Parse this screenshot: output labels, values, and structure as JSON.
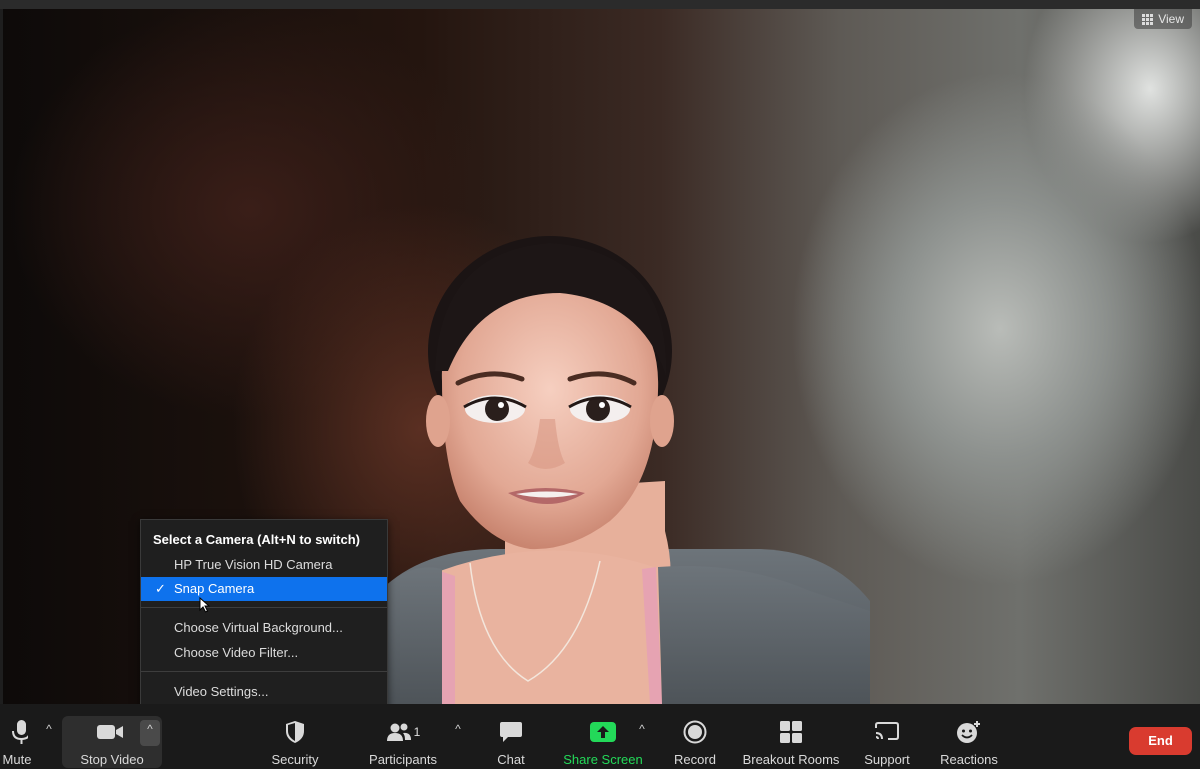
{
  "view_button": {
    "label": "View",
    "icon": "grid-icon"
  },
  "camera_menu": {
    "header": "Select a Camera (Alt+N to switch)",
    "cameras": [
      {
        "label": "HP True Vision HD Camera",
        "selected": false
      },
      {
        "label": "Snap Camera",
        "selected": true,
        "check": "✓"
      }
    ],
    "options": [
      {
        "label": "Choose Virtual Background..."
      },
      {
        "label": "Choose Video Filter..."
      }
    ],
    "settings": {
      "label": "Video Settings..."
    }
  },
  "toolbar": {
    "mute": {
      "label": "Mute",
      "icon": "microphone-icon"
    },
    "stop_video": {
      "label": "Stop Video",
      "icon": "video-camera-icon"
    },
    "security": {
      "label": "Security",
      "icon": "shield-icon"
    },
    "participants": {
      "label": "Participants",
      "icon": "people-icon",
      "count": "1"
    },
    "chat": {
      "label": "Chat",
      "icon": "chat-bubble-icon"
    },
    "share_screen": {
      "label": "Share Screen",
      "icon": "share-arrow-icon"
    },
    "record": {
      "label": "Record",
      "icon": "record-icon"
    },
    "breakout_rooms": {
      "label": "Breakout Rooms",
      "icon": "grid-squares-icon"
    },
    "support": {
      "label": "Support",
      "icon": "cast-icon"
    },
    "reactions": {
      "label": "Reactions",
      "icon": "smiley-plus-icon"
    },
    "end": {
      "label": "End"
    },
    "caret": "^"
  },
  "colors": {
    "accent_blue": "#0e72ed",
    "share_green": "#23d959",
    "end_red": "#d93b2f",
    "toolbar_bg": "#1a1a1a"
  }
}
